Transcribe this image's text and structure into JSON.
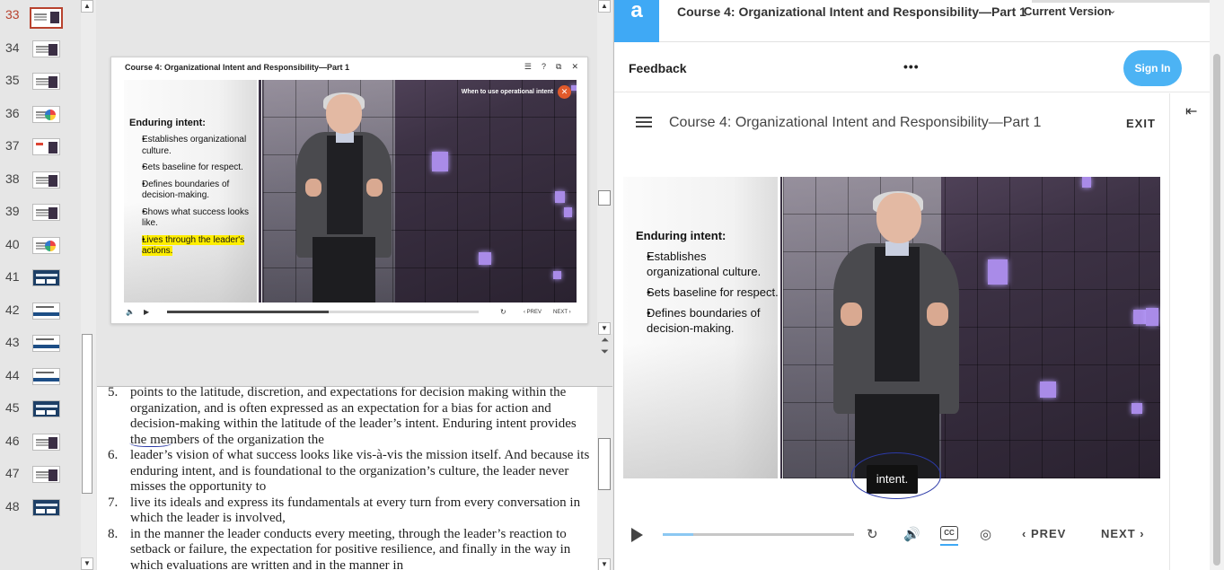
{
  "thumbnails": [
    {
      "num": "33",
      "kind": "video",
      "active": true
    },
    {
      "num": "34",
      "kind": "video"
    },
    {
      "num": "35",
      "kind": "video"
    },
    {
      "num": "36",
      "kind": "wheel"
    },
    {
      "num": "37",
      "kind": "redvideo"
    },
    {
      "num": "38",
      "kind": "video"
    },
    {
      "num": "39",
      "kind": "video"
    },
    {
      "num": "40",
      "kind": "wheel"
    },
    {
      "num": "41",
      "kind": "dark"
    },
    {
      "num": "42",
      "kind": "whiteblue"
    },
    {
      "num": "43",
      "kind": "whiteblue"
    },
    {
      "num": "44",
      "kind": "whiteblue"
    },
    {
      "num": "45",
      "kind": "dark"
    },
    {
      "num": "46",
      "kind": "video"
    },
    {
      "num": "47",
      "kind": "video"
    },
    {
      "num": "48",
      "kind": "dark"
    }
  ],
  "slide": {
    "title": "Course 4: Organizational Intent and Responsibility—Part 1",
    "controls": [
      "☰",
      "?",
      "⧉",
      "✕"
    ],
    "when_to_use": "When to use operational intent",
    "enduring_title": "Enduring intent:",
    "bullets": [
      "Establishes organizational culture.",
      "Sets baseline for respect.",
      "Defines boundaries of decision-making.",
      "Shows what success looks like.",
      "Lives through the leader's actions."
    ],
    "player": {
      "prev": "PREV",
      "next": "NEXT",
      "progress": 0.52
    }
  },
  "notes": [
    {
      "n": "5.",
      "t": "points to the latitude, discretion, and expectations for decision making within the organization, and is often expressed as an expectation for a bias for action and decision-making within the latitude of the leader’s intent. Enduring intent provides the members of the organization the"
    },
    {
      "n": "6.",
      "t": "leader’s vision of what success looks like vis-à-vis the mission itself. And because its enduring intent, and is foundational to the organization’s culture, the leader never misses the opportunity to"
    },
    {
      "n": "7.",
      "t": "live its ideals and express its fundamentals at every turn from every conversation in which the leader is involved,"
    },
    {
      "n": "8.",
      "t": "in the manner the leader conducts every meeting, through the leader’s reaction to setback or failure, the expectation for positive resilience, and finally in the way in which evaluations are written and in the manner in"
    }
  ],
  "web": {
    "logo": "a",
    "header_title": "Course 4: Organizational Intent and Responsibility—Part 1",
    "version": "Current Version",
    "feedback": "Feedback",
    "more": "•••",
    "sign_in": "Sign In",
    "course_title": "Course 4: Organizational Intent and Responsibility—Part 1",
    "exit": "EXIT",
    "enduring_title": "Enduring intent:",
    "bullets": [
      "Establishes organizational culture.",
      "Sets baseline for respect.",
      "Defines boundaries of decision-making."
    ],
    "caption": "intent.",
    "progress": 0.16,
    "prev": "PREV",
    "next": "NEXT",
    "accent": "#3fa9f5"
  }
}
